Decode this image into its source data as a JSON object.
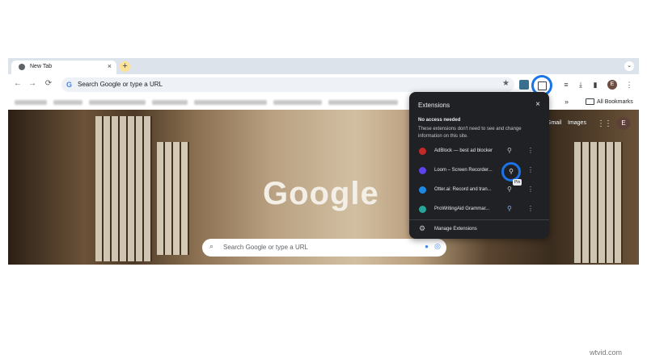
{
  "tab": {
    "title": "New Tab",
    "close": "×"
  },
  "tabstrip": {
    "new_tab": "+",
    "dropdown": "⌄"
  },
  "toolbar": {
    "back": "←",
    "forward": "→",
    "reload": "⟳",
    "omnibox_placeholder": "Search Google or type a URL",
    "bookmark_star": "★",
    "profile_initial": "E"
  },
  "bookmarks": {
    "more": "»",
    "all_label": "All Bookmarks"
  },
  "ntp": {
    "gmail": "Gmail",
    "images": "Images",
    "apps_icon": "⋮⋮",
    "profile_initial": "E",
    "logo": "Google",
    "search_placeholder": "Search Google or type a URL"
  },
  "extensions_popup": {
    "title": "Extensions",
    "close": "×",
    "section": "No access needed",
    "description": "These extensions don't need to see and change information on this site.",
    "items": [
      {
        "name": "AdBlock — best ad blocker",
        "icon_color": "#c62828",
        "pinned": false
      },
      {
        "name": "Loom – Screen Recorder...",
        "icon_color": "#5b43f0",
        "pinned": false,
        "tooltip": "Pin"
      },
      {
        "name": "Otter.ai: Record and tran...",
        "icon_color": "#1e88e5",
        "pinned": false
      },
      {
        "name": "ProWritingAid Grammar...",
        "icon_color": "#26a69a",
        "pinned": true
      }
    ],
    "manage": "Manage Extensions"
  },
  "colors": {
    "accent": "#1a73e8",
    "popup_bg": "#202124"
  },
  "watermark": "wtvid.com"
}
